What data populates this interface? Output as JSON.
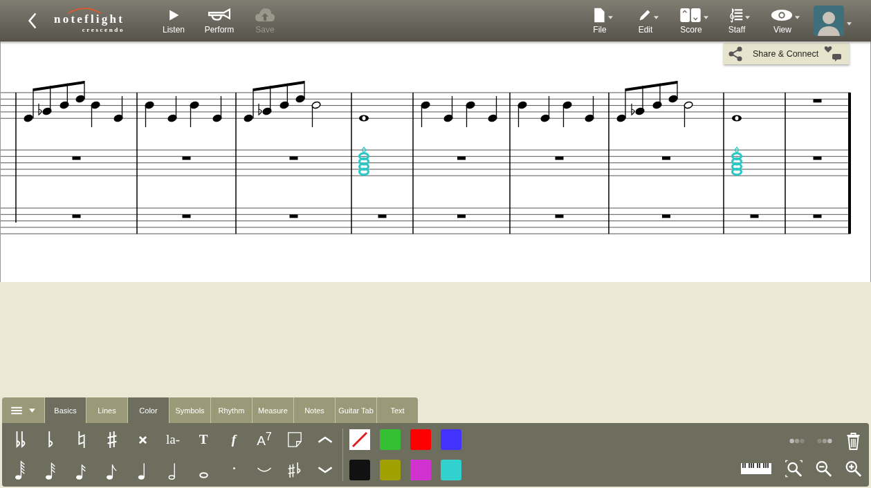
{
  "header": {
    "logo": {
      "name": "noteflight",
      "tagline": "crescendo"
    },
    "left_buttons": [
      {
        "kind": "play",
        "label": "Listen",
        "disabled": false
      },
      {
        "kind": "horn",
        "label": "Perform",
        "disabled": false
      },
      {
        "kind": "cloud",
        "label": "Save",
        "disabled": true
      }
    ],
    "menus": [
      {
        "kind": "file",
        "label": "File"
      },
      {
        "kind": "edit",
        "label": "Edit"
      },
      {
        "kind": "score",
        "label": "Score"
      },
      {
        "kind": "staff",
        "label": "Staff"
      },
      {
        "kind": "view",
        "label": "View"
      }
    ]
  },
  "share_panel": {
    "label": "Share & Connect"
  },
  "palette": {
    "tabs": [
      {
        "label": "Basics",
        "selected": true
      },
      {
        "label": "Lines",
        "selected": false
      },
      {
        "label": "Color",
        "selected": true
      },
      {
        "label": "Symbols",
        "selected": false
      },
      {
        "label": "Rhythm",
        "selected": false
      },
      {
        "label": "Measure",
        "selected": false
      },
      {
        "label": "Notes",
        "selected": false
      },
      {
        "label": "Guitar Tab",
        "selected": false
      },
      {
        "label": "Text",
        "selected": false
      }
    ],
    "text_tools": [
      "la-",
      "T",
      "f",
      "A$^{7}$"
    ],
    "swatches": [
      {
        "kind": "none"
      },
      {
        "kind": "color",
        "color": "#33c033"
      },
      {
        "kind": "color",
        "color": "#ff0000"
      },
      {
        "kind": "color",
        "color": "#4433ff"
      },
      {
        "kind": "color",
        "color": "#111111"
      },
      {
        "kind": "color",
        "color": "#a0a000"
      },
      {
        "kind": "color",
        "color": "#d033d0"
      },
      {
        "kind": "color",
        "color": "#33d0d0"
      }
    ]
  }
}
